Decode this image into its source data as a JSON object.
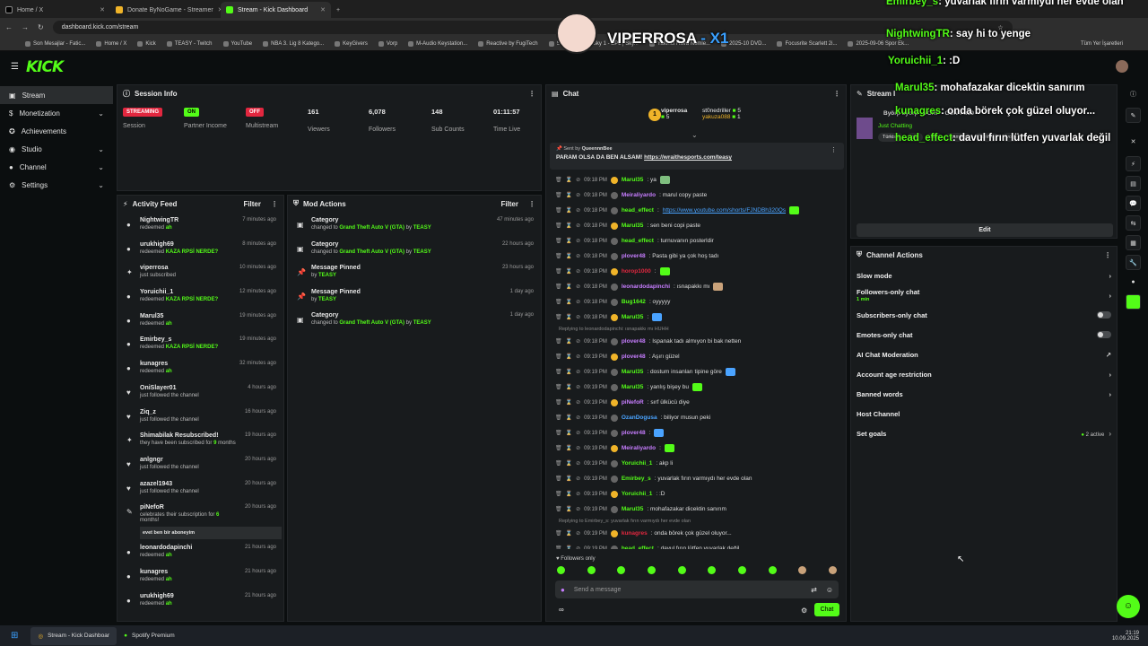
{
  "browser": {
    "tabs": [
      {
        "title": "Home / X"
      },
      {
        "title": "Donate ByNoGame - Streamer"
      },
      {
        "title": "Stream - Kick Dashboard"
      }
    ],
    "url": "dashboard.kick.com/stream",
    "bookmarks": [
      "Son Mesajlar - Fatic...",
      "Home / X",
      "Kick",
      "TEASY - Twitch",
      "YouTube",
      "NBA 3. Lig 8 Katego...",
      "KeyGivers",
      "Vorp",
      "M-Audio Keystation...",
      "Reactive by FugiTech",
      "Stream",
      "Sky 1 - EPL | Sky...",
      "Yakıncı Hava Nemle...",
      "2025-10 DVD...",
      "Focusrite Scarlett 2i...",
      "2025-09-06 Spor Ek..."
    ],
    "all_bookmarks": "Tüm Yer İşaretleri"
  },
  "overlay": {
    "brand": "VIPERROSA",
    "brand_x": " - X1",
    "messages": [
      {
        "user": "Emirbey_s",
        "text": ": yuvarlak fırın varmıydı her evde olan"
      },
      {
        "user": "NightwingTR",
        "text": ": say hi to yenge"
      },
      {
        "user": "Yoruichii_1",
        "text": ": :D"
      },
      {
        "user": "Marul35",
        "text": ":  mohafazakar dicektin sanırım"
      },
      {
        "user": "kunagres",
        "text": ": onda börek çok güzel oluyor..."
      },
      {
        "user": "head_effect",
        "text": ": davul fırın lütfen yuvarlak değil"
      }
    ]
  },
  "sidebar": {
    "items": [
      {
        "label": "Stream"
      },
      {
        "label": "Monetization"
      },
      {
        "label": "Achievements"
      },
      {
        "label": "Studio"
      },
      {
        "label": "Channel"
      },
      {
        "label": "Settings"
      }
    ]
  },
  "session": {
    "title": "Session Info",
    "stats": [
      {
        "badge": "STREAMING",
        "label": "Session",
        "color": "#e2273f"
      },
      {
        "badge": "ON",
        "label": "Partner Income",
        "color": "#53fc18"
      },
      {
        "badge": "OFF",
        "label": "Multistream",
        "color": "#e2273f"
      },
      {
        "value": "161",
        "label": "Viewers"
      },
      {
        "value": "6,078",
        "label": "Followers"
      },
      {
        "value": "148",
        "label": "Sub Counts"
      },
      {
        "value": "01:11:57",
        "label": "Time Live"
      }
    ]
  },
  "activity": {
    "title": "Activity Feed",
    "filter": "Filter",
    "rows": [
      {
        "name": "NightwingTR",
        "sub": "redeemed ",
        "hl": "ah",
        "time": "7 minutes ago"
      },
      {
        "name": "urukhigh69",
        "sub": "redeemed ",
        "hl": "KAZA RPSİ NERDE?",
        "time": "8 minutes ago"
      },
      {
        "name": "viperrosa",
        "sub": "just subscribed",
        "hl": "",
        "time": "10 minutes ago"
      },
      {
        "name": "Yoruichii_1",
        "sub": "redeemed ",
        "hl": "KAZA RPSİ NERDE?",
        "time": "12 minutes ago"
      },
      {
        "name": "Marul35",
        "sub": "redeemed ",
        "hl": "ah",
        "time": "19 minutes ago"
      },
      {
        "name": "Emirbey_s",
        "sub": "redeemed ",
        "hl": "KAZA RPSİ NERDE?",
        "time": "19 minutes ago"
      },
      {
        "name": "kunagres",
        "sub": "redeemed ",
        "hl": "ah",
        "time": "32 minutes ago"
      },
      {
        "name": "OniSlayer01",
        "sub": "just followed the channel",
        "hl": "",
        "time": "4 hours ago"
      },
      {
        "name": "Ziq_z",
        "sub": "just followed the channel",
        "hl": "",
        "time": "16 hours ago"
      },
      {
        "name": "Shimabilak Resubscribed!",
        "sub": "they have been subscribed for ",
        "hl": "9",
        "sub2": " months",
        "time": "19 hours ago"
      },
      {
        "name": "anlgngr",
        "sub": "just followed the channel",
        "hl": "",
        "time": "20 hours ago"
      },
      {
        "name": "azazel1943",
        "sub": "just followed the channel",
        "hl": "",
        "time": "20 hours ago"
      },
      {
        "name": "piNefoR",
        "sub": "celebrates their subscription for ",
        "hl": "6",
        "sub2": " months!",
        "time": "20 hours ago",
        "note": "evet ben bir aboneyim"
      },
      {
        "name": "leonardodapinchi",
        "sub": "redeemed ",
        "hl": "ah",
        "time": "21 hours ago"
      },
      {
        "name": "kunagres",
        "sub": "redeemed ",
        "hl": "ah",
        "time": "21 hours ago"
      },
      {
        "name": "urukhigh69",
        "sub": "redeemed ",
        "hl": "ah",
        "time": "21 hours ago"
      }
    ]
  },
  "mod": {
    "title": "Mod Actions",
    "filter": "Filter",
    "rows": [
      {
        "name": "Category",
        "pre": "changed to ",
        "game": "Grand Theft Auto V (GTA)",
        "by": " by ",
        "who": "TEASY",
        "time": "47 minutes ago"
      },
      {
        "name": "Category",
        "pre": "changed to ",
        "game": "Grand Theft Auto V (GTA)",
        "by": " by ",
        "who": "TEASY",
        "time": "22 hours ago"
      },
      {
        "name": "Message Pinned",
        "pre": "",
        "game": "",
        "by": "by ",
        "who": "TEASY",
        "time": "23 hours ago"
      },
      {
        "name": "Message Pinned",
        "pre": "",
        "game": "",
        "by": "by ",
        "who": "TEASY",
        "time": "1 day ago"
      },
      {
        "name": "Category",
        "pre": "changed to ",
        "game": "Grand Theft Auto V (GTA)",
        "by": " by ",
        "who": "TEASY",
        "time": "1 day ago"
      }
    ]
  },
  "chat": {
    "title": "Chat",
    "top": [
      {
        "name": "viperrosa",
        "n": "5",
        "c": "#53fc18"
      },
      {
        "name": "st0nedriller",
        "n": "5",
        "c": "#ddd"
      },
      {
        "name": "yakuza088",
        "n": "1",
        "c": "#f0b429"
      }
    ],
    "pinned_by": "Sent by ",
    "pinned_user": "QueennnBee",
    "pinned_text": "PARAM OLSA DA BEN ALSAM! ",
    "pinned_link": "https://wraithesports.com/teasy",
    "followers_only": "Followers only",
    "placeholder": "Send a message",
    "send": "Chat",
    "lines": [
      {
        "t": "09:18 PM",
        "u": "Marul35",
        "c": "#53fc18",
        "m": ": ya "
      },
      {
        "t": "09:18 PM",
        "u": "Meiraliyardo",
        "c": "#c77dff",
        "m": ": marul copy paste"
      },
      {
        "t": "09:18 PM",
        "u": "head_effect",
        "c": "#53fc18",
        "m": ": ",
        "link": "https://www.youtube.com/shorts/FJNDBh320Qs"
      },
      {
        "t": "09:18 PM",
        "u": "Marul35",
        "c": "#53fc18",
        "m": ": sen beni copi paste"
      },
      {
        "t": "09:18 PM",
        "u": "head_effect",
        "c": "#53fc18",
        "m": ": turnuvanın posterldir"
      },
      {
        "t": "09:18 PM",
        "u": "plover48",
        "c": "#c77dff",
        "m": ": Pasta gibi ya çok hoş tadı"
      },
      {
        "t": "09:18 PM",
        "u": "horop1000",
        "c": "#e2273f",
        "m": ": "
      },
      {
        "t": "09:18 PM",
        "u": "leonardodapinchi",
        "c": "#c77dff",
        "m": ": ısnapakkı mı "
      },
      {
        "t": "09:18 PM",
        "u": "Bug1642",
        "c": "#53fc18",
        "m": ": oyyyyy"
      },
      {
        "t": "09:18 PM",
        "u": "Marul35",
        "c": "#53fc18",
        "m": ": "
      },
      {
        "reply": "Replying to leonardodapinchi: ısnapakkı mı HUHH"
      },
      {
        "t": "09:18 PM",
        "u": "plover48",
        "c": "#c77dff",
        "m": ": Ispanak tadı almıyon bi bak netten"
      },
      {
        "t": "09:19 PM",
        "u": "plover48",
        "c": "#c77dff",
        "m": ": Aşırı güzel"
      },
      {
        "t": "09:19 PM",
        "u": "Marul35",
        "c": "#53fc18",
        "m": ": dostum insanları tipine göre "
      },
      {
        "t": "09:19 PM",
        "u": "Marul35",
        "c": "#53fc18",
        "m": ": yanlış bişey bu "
      },
      {
        "t": "09:19 PM",
        "u": "piNefoR",
        "c": "#c77dff",
        "m": ": sırf ülkücü diye"
      },
      {
        "t": "09:19 PM",
        "u": "OzanDogusa",
        "c": "#4aa3ff",
        "m": ": biliyor musun peki"
      },
      {
        "t": "09:19 PM",
        "u": "plover48",
        "c": "#c77dff",
        "m": ": "
      },
      {
        "t": "09:19 PM",
        "u": "Meiraliyardo",
        "c": "#c77dff",
        "m": ": "
      },
      {
        "t": "09:19 PM",
        "u": "Yoruichii_1",
        "c": "#53fc18",
        "m": ": akp li"
      },
      {
        "t": "09:19 PM",
        "u": "Emirbey_s",
        "c": "#53fc18",
        "m": ": yuvarlak fırın varmıydı her evde olan"
      },
      {
        "t": "09:19 PM",
        "u": "Yoruichii_1",
        "c": "#53fc18",
        "m": ": :D"
      },
      {
        "t": "09:19 PM",
        "u": "Marul35",
        "c": "#53fc18",
        "m": ":  mohafazakar dicektin sanırım"
      },
      {
        "reply": "Replying to Emirbey_s: yuvarlak fırın varmıydı her evde olan"
      },
      {
        "t": "09:19 PM",
        "u": "kunagres",
        "c": "#e2273f",
        "m": ": onda börek çok güzel oluyor..."
      },
      {
        "t": "09:19 PM",
        "u": "head_effect",
        "c": "#53fc18",
        "m": ": davul fırın lütfen yuvarlak değil"
      }
    ]
  },
  "stream_panel": {
    "title": "Stream I",
    "stream_title": "Byörp byörp - VORP - GÜN 74/29",
    "category": "Just Chatting",
    "tags": [
      "Türkish",
      "gta",
      "RP",
      "gaming",
      "Türkçe",
      "vorp"
    ],
    "edit": "Edit"
  },
  "actions": {
    "title": "Channel Actions",
    "rows": [
      {
        "label": "Slow mode",
        "kind": "chev"
      },
      {
        "label": "Followers-only chat",
        "sub": "1 min",
        "kind": "chev"
      },
      {
        "label": "Subscribers-only chat",
        "kind": "toggle"
      },
      {
        "label": "Emotes-only chat",
        "kind": "toggle"
      },
      {
        "label": "AI Chat Moderation",
        "kind": "ext"
      },
      {
        "label": "Account age restriction",
        "kind": "chev"
      },
      {
        "label": "Banned words",
        "kind": "chev"
      },
      {
        "label": "Host Channel",
        "kind": "none"
      },
      {
        "label": "Set goals",
        "kind": "goals",
        "extra": "2 active"
      }
    ]
  },
  "taskbar": {
    "apps": [
      "Stream - Kick Dashboar",
      "Spotify Premium"
    ],
    "time": "21:19",
    "date": "10.09.2025"
  }
}
